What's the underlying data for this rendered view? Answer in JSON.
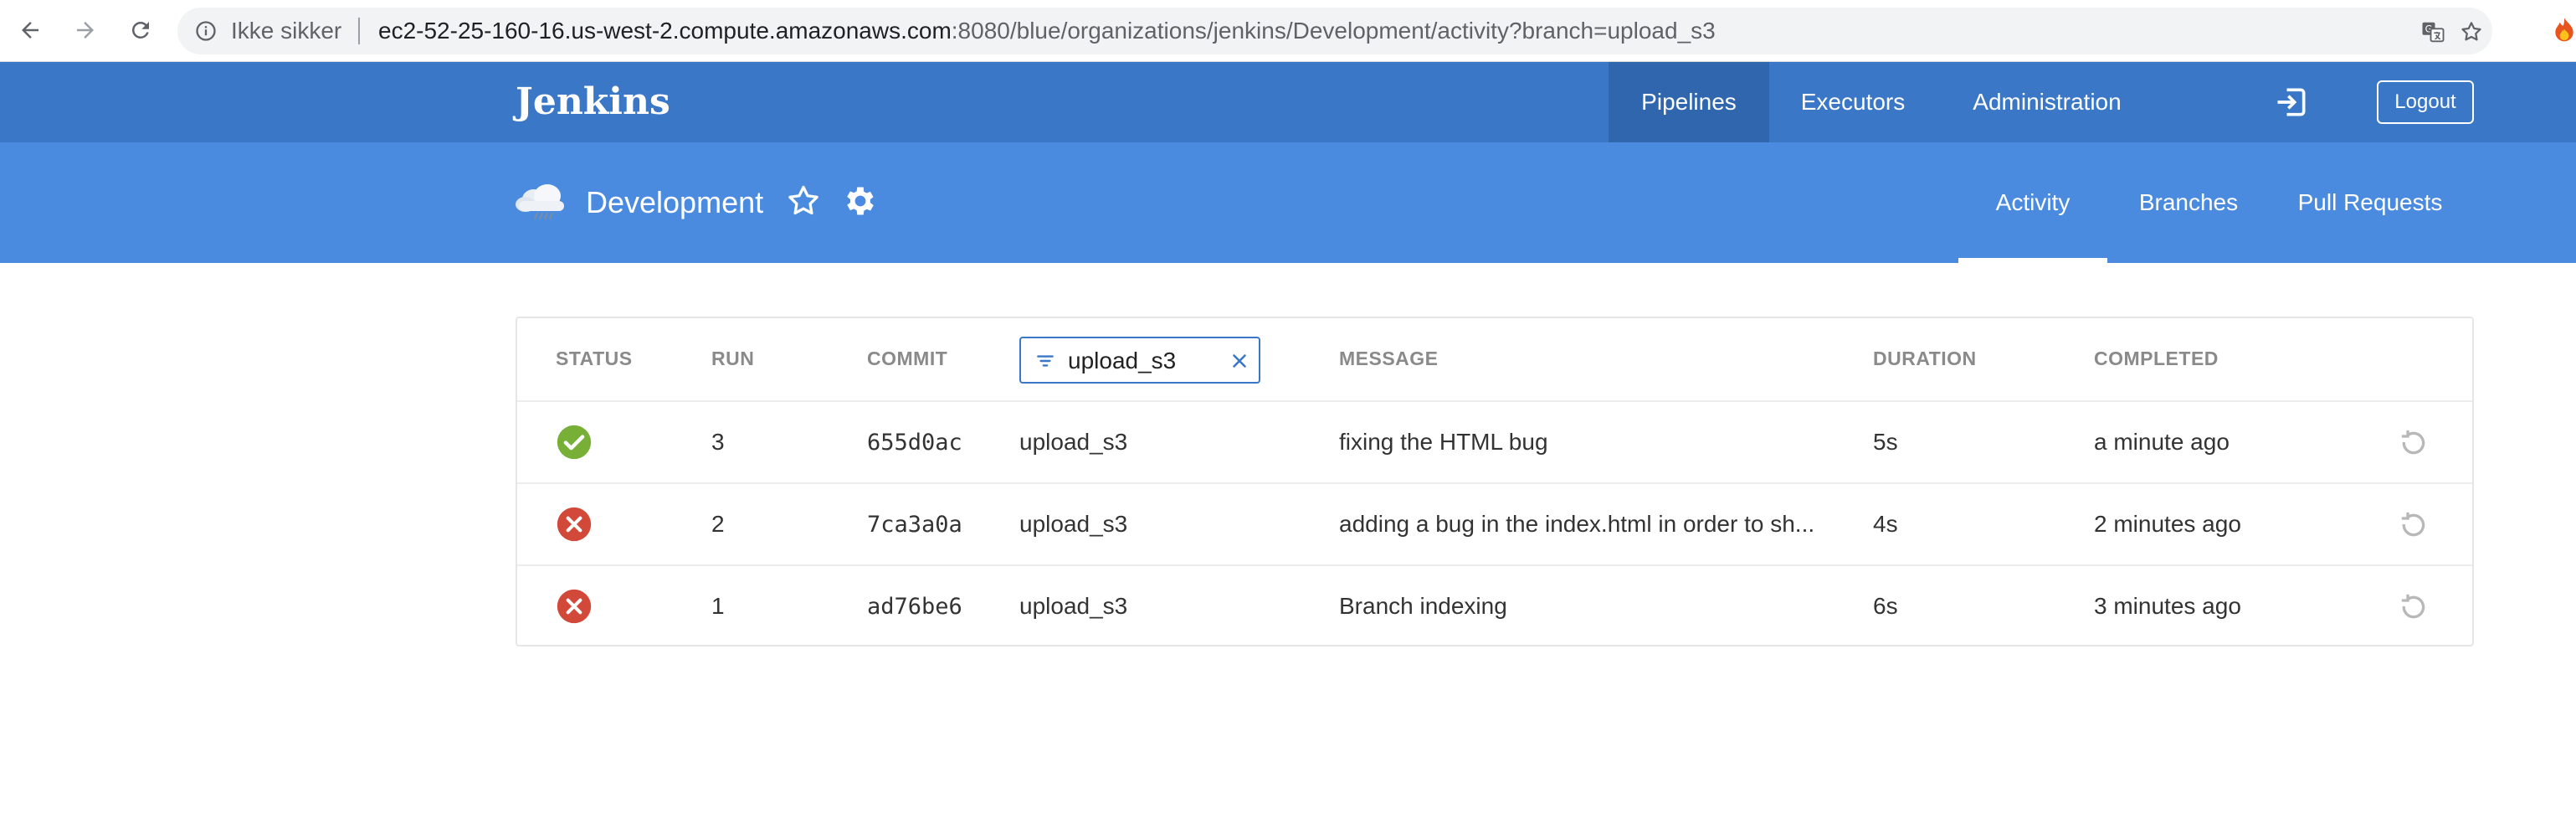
{
  "browser": {
    "security_label": "Ikke sikker",
    "url_host": "ec2-52-25-160-16.us-west-2.compute.amazonaws.com",
    "url_rest": ":8080/blue/organizations/jenkins/Development/activity?branch=upload_s3"
  },
  "topbar": {
    "brand": "Jenkins",
    "nav": [
      "Pipelines",
      "Executors",
      "Administration"
    ],
    "active_nav": "Pipelines",
    "logout_label": "Logout"
  },
  "pipeline": {
    "name": "Development",
    "tabs": [
      "Activity",
      "Branches",
      "Pull Requests"
    ],
    "active_tab": "Activity"
  },
  "table": {
    "headers": {
      "status": "STATUS",
      "run": "RUN",
      "commit": "COMMIT",
      "message": "MESSAGE",
      "duration": "DURATION",
      "completed": "COMPLETED"
    },
    "branch_filter": "upload_s3",
    "rows": [
      {
        "status": "success",
        "run": "3",
        "commit": "655d0ac",
        "branch": "upload_s3",
        "message": "fixing the HTML bug",
        "duration": "5s",
        "completed": "a minute ago"
      },
      {
        "status": "failure",
        "run": "2",
        "commit": "7ca3a0a",
        "branch": "upload_s3",
        "message": "adding a bug in the index.html in order to sh...",
        "duration": "4s",
        "completed": "2 minutes ago"
      },
      {
        "status": "failure",
        "run": "1",
        "commit": "ad76be6",
        "branch": "upload_s3",
        "message": "Branch indexing",
        "duration": "6s",
        "completed": "3 minutes ago"
      }
    ]
  },
  "colors": {
    "topbar": "#3a77c7",
    "pipeline_header": "#4a8be0",
    "success": "#78b037",
    "failure": "#d24939"
  }
}
